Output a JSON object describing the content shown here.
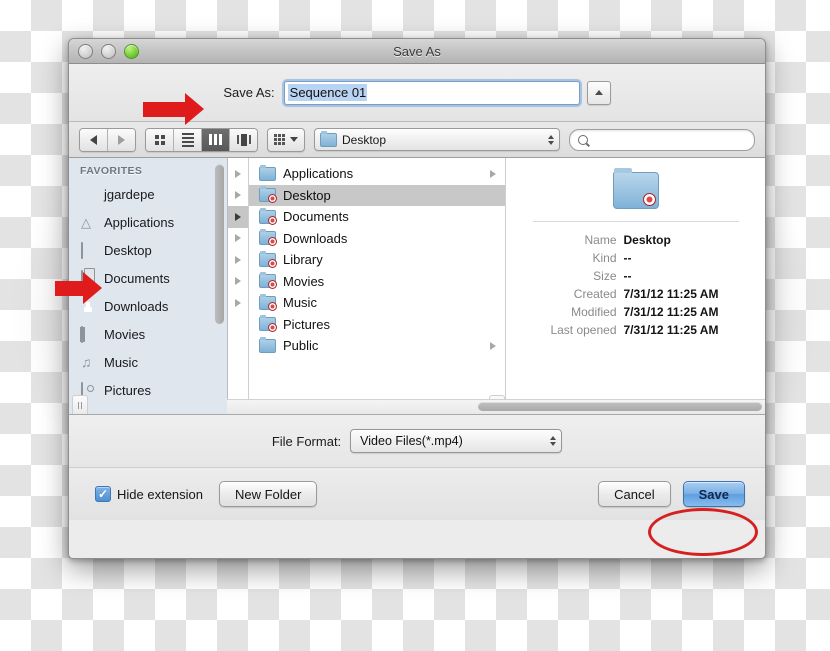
{
  "window": {
    "title": "Save As",
    "traffic_lights": [
      "close",
      "minimize",
      "zoom"
    ]
  },
  "name_row": {
    "label": "Save As:",
    "value": "Sequence 01",
    "disclose_icon": "triangle-up-icon"
  },
  "toolbar": {
    "back_icon": "back-arrow-icon",
    "forward_icon": "forward-arrow-icon",
    "view_modes": [
      {
        "name": "icon-view",
        "icon": "grid-icon",
        "active": false
      },
      {
        "name": "list-view",
        "icon": "list-icon",
        "active": false
      },
      {
        "name": "column-view",
        "icon": "columns-icon",
        "active": true
      },
      {
        "name": "coverflow-view",
        "icon": "coverflow-icon",
        "active": false
      }
    ],
    "arrange_icon": "arrange-grid-icon",
    "path_popup": "Desktop",
    "search_placeholder": ""
  },
  "sidebar": {
    "header": "FAVORITES",
    "items": [
      {
        "label": "jgardepe",
        "icon": "home-icon"
      },
      {
        "label": "Applications",
        "icon": "applications-icon"
      },
      {
        "label": "Desktop",
        "icon": "desktop-icon"
      },
      {
        "label": "Documents",
        "icon": "documents-icon"
      },
      {
        "label": "Downloads",
        "icon": "downloads-icon"
      },
      {
        "label": "Movies",
        "icon": "movies-icon"
      },
      {
        "label": "Music",
        "icon": "music-icon"
      },
      {
        "label": "Pictures",
        "icon": "pictures-icon"
      }
    ]
  },
  "file_list": {
    "items": [
      {
        "label": "Applications",
        "selected": false,
        "restricted": false,
        "has_children": true
      },
      {
        "label": "Desktop",
        "selected": true,
        "restricted": true,
        "has_children": false
      },
      {
        "label": "Documents",
        "selected": false,
        "restricted": true,
        "has_children": false
      },
      {
        "label": "Downloads",
        "selected": false,
        "restricted": true,
        "has_children": false
      },
      {
        "label": "Library",
        "selected": false,
        "restricted": true,
        "has_children": false
      },
      {
        "label": "Movies",
        "selected": false,
        "restricted": true,
        "has_children": false
      },
      {
        "label": "Music",
        "selected": false,
        "restricted": true,
        "has_children": false
      },
      {
        "label": "Pictures",
        "selected": false,
        "restricted": true,
        "has_children": false
      },
      {
        "label": "Public",
        "selected": false,
        "restricted": false,
        "has_children": true
      }
    ]
  },
  "info_panel": {
    "folder_icon": "folder-restricted-icon",
    "rows": [
      {
        "key": "Name",
        "value": "Desktop"
      },
      {
        "key": "Kind",
        "value": "--"
      },
      {
        "key": "Size",
        "value": "--"
      },
      {
        "key": "Created",
        "value": "7/31/12 11:25 AM"
      },
      {
        "key": "Modified",
        "value": "7/31/12 11:25 AM"
      },
      {
        "key": "Last opened",
        "value": "7/31/12 11:25 AM"
      }
    ]
  },
  "format_row": {
    "label": "File Format:",
    "value": "Video Files(*.mp4)"
  },
  "bottom_bar": {
    "hide_extension_label": "Hide extension",
    "hide_extension_checked": true,
    "check_glyph": "✓",
    "new_folder_label": "New Folder",
    "cancel_label": "Cancel",
    "save_label": "Save"
  },
  "annotations": {
    "arrow_color": "#e01b1b",
    "ellipse_color": "#d61f1f",
    "arrow_targets": [
      "save-as-label",
      "sidebar-item-desktop"
    ],
    "ellipse_target": "save-button"
  }
}
